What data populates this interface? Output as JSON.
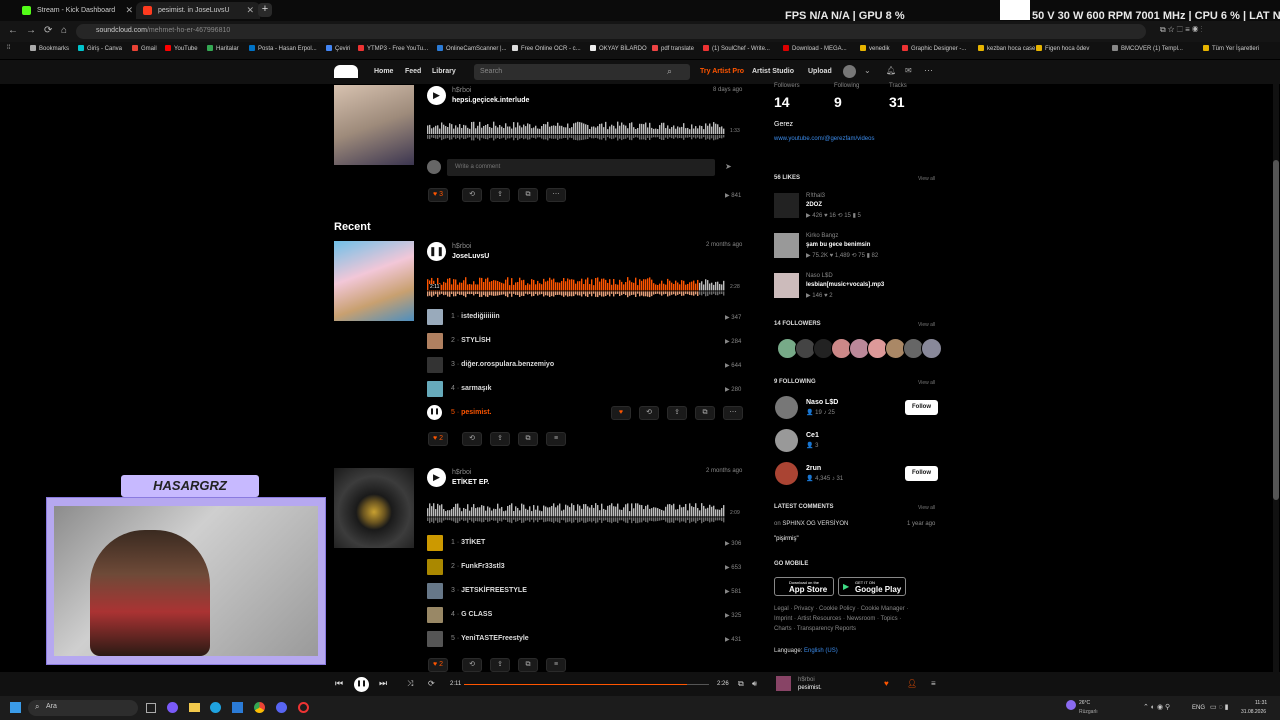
{
  "browser": {
    "tabs": [
      {
        "title": "Stream - Kick Dashboard",
        "color": "#53fc18"
      },
      {
        "title": "pesimist. in JoseLuvsU",
        "color": "#ff3b1f"
      }
    ],
    "url_host": "soundcloud.com",
    "url_path": "/mehmet-ho-er-467996810",
    "bookmarks": [
      "Bookmarks",
      "Giriş - Canva",
      "Gmail",
      "YouTube",
      "Haritalar",
      "Posta - Hasan Erpol...",
      "Çeviri",
      "YTMP3 - Free YouTu...",
      "OnlineCamScanner |...",
      "Free Online OCR - c...",
      "OKYAY BİLARDO",
      "pdf translate",
      "(1) SoulChef - Write...",
      "Download - MEGA...",
      "venedik",
      "Graphic Designer -...",
      "kezban hoca case",
      "Figen hoca ödev",
      "BMCOVER (1) Templ...",
      "Tüm Yer İşaretleri"
    ]
  },
  "overlay": {
    "stats": "FPS  N/A  N/A  |  GPU  8 %",
    "stats2": "50 V  30 W  600 RPM  7001 MHz  |  CPU  6 %  |  LAT  N/A  N/A"
  },
  "header": {
    "home": "Home",
    "feed": "Feed",
    "library": "Library",
    "search_placeholder": "Search",
    "try_pro": "Try Artist Pro",
    "artist_studio": "Artist Studio",
    "upload": "Upload"
  },
  "post1": {
    "user": "h$rboi",
    "title": "hepsi.geçicek.interlude",
    "time": "8 days ago",
    "duration": "1:33",
    "comment_placeholder": "Write a comment",
    "likes": "3",
    "plays": "841"
  },
  "recent_label": "Recent",
  "post2": {
    "user": "h$rboi",
    "title": "JoseLuvsU",
    "time": "2 months ago",
    "elapsed": "2:11",
    "duration": "2:28",
    "likes": "2",
    "tracks": [
      {
        "n": "1",
        "name": "istediğiiiiiin",
        "plays": "347"
      },
      {
        "n": "2",
        "name": "STYLİSH",
        "plays": "284"
      },
      {
        "n": "3",
        "name": "diğer.orospulara.benzemiyo",
        "plays": "644"
      },
      {
        "n": "4",
        "name": "sarmaşık",
        "plays": "280"
      },
      {
        "n": "5",
        "name": "pesimist.",
        "plays": ""
      }
    ]
  },
  "post3": {
    "user": "h$rboi",
    "title": "ETİKET EP.",
    "time": "2 months ago",
    "duration": "2:09",
    "likes": "2",
    "tracks": [
      {
        "n": "1",
        "name": "3TİKET",
        "plays": "306"
      },
      {
        "n": "2",
        "name": "FunkFr33stl3",
        "plays": "653"
      },
      {
        "n": "3",
        "name": "JETSKİFREESTYLE",
        "plays": "581"
      },
      {
        "n": "4",
        "name": "G CLASS",
        "plays": "325"
      },
      {
        "n": "5",
        "name": "YeniTASTEFreestyle",
        "plays": "431"
      }
    ]
  },
  "side": {
    "followers_label": "Followers",
    "followers": "14",
    "following_label": "Following",
    "following": "9",
    "tracks_label": "Tracks",
    "tracks": "31",
    "bio": "Gerez",
    "link": "www.youtube.com/@gerezfam/videos",
    "likes_header": "56 LIKES",
    "view_all": "View all",
    "likes": [
      {
        "user": "R!thal3",
        "title": "2DOZ",
        "stats": "▶ 426  ♥ 16  ⟲ 15  ▮ 5"
      },
      {
        "user": "Kirko Bangz",
        "title": "şam bu gece benimsin",
        "stats": "▶ 75.2K  ♥ 1,489  ⟲ 75  ▮ 82"
      },
      {
        "user": "Naso L$D",
        "title": "lesbian[music+vocals].mp3",
        "stats": "▶ 146  ♥ 2"
      }
    ],
    "followers_header": "14 FOLLOWERS",
    "following_header": "9 FOLLOWING",
    "following_list": [
      {
        "name": "Naso L$D",
        "stats": "👤 19  ♪ 25",
        "follow": "Follow"
      },
      {
        "name": "Ce1",
        "stats": "👤 3",
        "follow": ""
      },
      {
        "name": "2run",
        "stats": "👤 4,345  ♪ 31",
        "follow": "Follow"
      }
    ],
    "latest_header": "LATEST COMMENTS",
    "comment_on": "on",
    "comment_track": "SPHINX OG VERSİYON",
    "comment_time": "1 year ago",
    "comment_text": "\"pişirmiş\"",
    "go_mobile": "GO MOBILE",
    "appstore_small": "Download on the",
    "appstore": "App Store",
    "gplay_small": "GET IT ON",
    "gplay": "Google Play",
    "footer1": "Legal · Privacy · Cookie Policy · Cookie Manager ·",
    "footer2": "Imprint · Artist Resources · Newsroom · Topics ·",
    "footer3": "Charts · Transparency Reports",
    "language_label": "Language:",
    "language": "English (US)"
  },
  "player": {
    "elapsed": "2:11",
    "duration": "2:26",
    "progress": 0.91,
    "user": "h$rboi",
    "track": "pesimist."
  },
  "cam": {
    "title": "HASARGRZ"
  },
  "taskbar": {
    "search": "Ara",
    "weather": "26°C",
    "weather2": "Rüzgarlı",
    "lang": "ENG",
    "time": "11:31",
    "date": "31.08.2026"
  },
  "colors": {
    "accent": "#ff5500",
    "bg": "#000000"
  }
}
